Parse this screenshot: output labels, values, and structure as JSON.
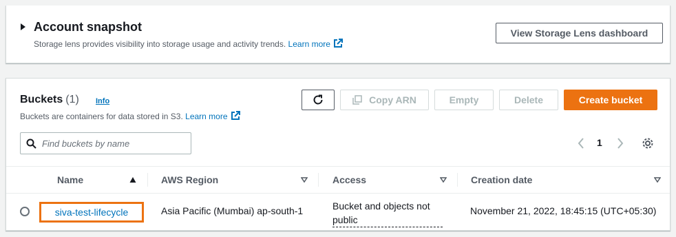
{
  "snapshot": {
    "title": "Account snapshot",
    "description": "Storage lens provides visibility into storage usage and activity trends.",
    "learn_more": "Learn more",
    "view_button": "View Storage Lens dashboard"
  },
  "buckets": {
    "title": "Buckets",
    "count": "(1)",
    "info": "Info",
    "description": "Buckets are containers for data stored in S3.",
    "learn_more": "Learn more",
    "buttons": {
      "copy_arn": "Copy ARN",
      "empty": "Empty",
      "delete": "Delete",
      "create": "Create bucket"
    },
    "search_placeholder": "Find buckets by name",
    "page": "1",
    "columns": [
      "Name",
      "AWS Region",
      "Access",
      "Creation date"
    ],
    "rows": [
      {
        "name": "siva-test-lifecycle",
        "region": "Asia Pacific (Mumbai) ap-south-1",
        "access_line1": "Bucket and objects not",
        "access_line2": "public",
        "created": "November 21, 2022, 18:45:15 (UTC+05:30)"
      }
    ]
  },
  "colors": {
    "primary": "#ec7211",
    "link": "#0073bb",
    "text": "#16191f"
  }
}
